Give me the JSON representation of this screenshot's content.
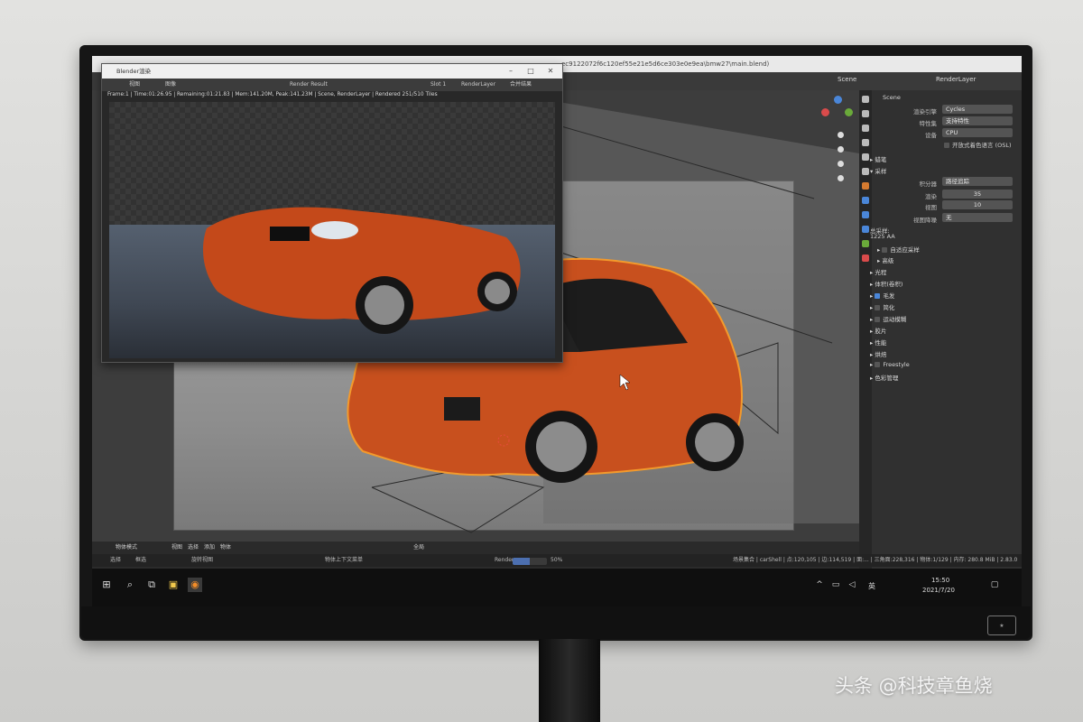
{
  "window": {
    "main_title_path": "ec9122072f6c120ef55e21e5d6ce303e0e9ea\\bmw27\\main.blend)",
    "scene": "Scene",
    "render_layer": "RenderLayer"
  },
  "render_window": {
    "title": "Blender渲染",
    "menu": [
      "视图",
      "图像"
    ],
    "image_name": "Render Result",
    "slot": "Slot 1",
    "layer": "RenderLayer",
    "composite": "合并结果",
    "stats": "Frame:1 | Time:01:26.95 | Remaining:01:21.83 | Mem:141.20M, Peak:141.23M | Scene, RenderLayer | Rendered 251/510 Tiles"
  },
  "properties": {
    "scene_label": "Scene",
    "render_engine_label": "渲染引擎",
    "render_engine": "Cycles",
    "feature_set_label": "特性集",
    "feature_set": "支持特性",
    "device_label": "设备",
    "device": "CPU",
    "osl_label": "开放式着色语言 (OSL)",
    "section_grease": "蜡笔",
    "section_sampling": "采样",
    "integrator_label": "积分器",
    "integrator": "路径追踪",
    "render_label": "渲染",
    "render_samples": "35",
    "viewport_label": "视图",
    "viewport_samples": "10",
    "denoise_label": "视图降噪",
    "denoise": "无",
    "total_samples_label": "总采样:",
    "total_samples": "1225 AA",
    "adaptive": "自适应采样",
    "advanced": "高级",
    "light_paths": "光程",
    "volumes": "体积(卷积)",
    "hair": "毛发",
    "simplify": "简化",
    "motion_blur": "运动模糊",
    "film": "胶片",
    "performance": "性能",
    "bake": "烘焙",
    "freestyle": "Freestyle",
    "color_mgmt": "色彩管理"
  },
  "viewport_header": {
    "mode": "物体模式",
    "menus": [
      "视图",
      "选择",
      "添加",
      "物体"
    ],
    "transform": "全局"
  },
  "status": {
    "select": "选择",
    "box_select": "框选",
    "rotate_view": "旋转视图",
    "context_menu": "物体上下文菜单",
    "render_label": "Render",
    "progress": 0.5,
    "progress_text": "50%",
    "scene_stats": "场景集合 | carShell | 点:120,105 | 边:114,519 | 面:... | 三角面:228,316 | 物体:1/129 | 内存: 280.8 MiB | 2.83.0"
  },
  "taskbar": {
    "ime": "英",
    "time": "15:50",
    "date": "2021/7/20"
  },
  "watermark": "头条 @科技章鱼烧",
  "colors": {
    "car_orange": "#c8501e",
    "selection_outline": "#f39a2c",
    "blender_dark": "#303030",
    "accent_blue": "#4a86d8"
  }
}
